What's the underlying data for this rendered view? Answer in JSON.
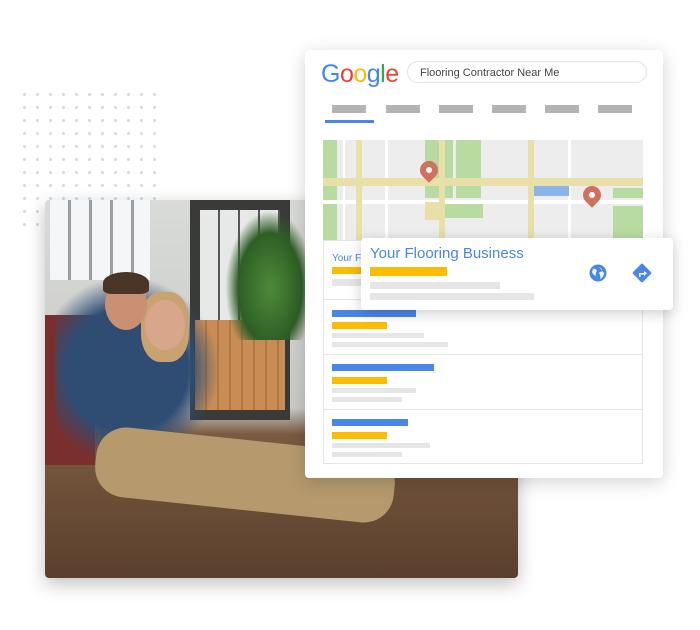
{
  "google_logo": {
    "letters": [
      "G",
      "o",
      "o",
      "g",
      "l",
      "e"
    ],
    "colors": [
      "#4285f4",
      "#ea4335",
      "#fbbc05",
      "#4285f4",
      "#34a853",
      "#ea4335"
    ]
  },
  "search": {
    "query": "Flooring Contractor Near Me"
  },
  "results": {
    "first_title_truncated": "Your F"
  },
  "popup": {
    "title": "Your Flooring Business",
    "icons": [
      "globe-icon",
      "directions-icon"
    ]
  },
  "colors": {
    "accent_blue": "#4a86e8",
    "accent_yellow": "#fbbc04",
    "pin": "#d0705f"
  }
}
